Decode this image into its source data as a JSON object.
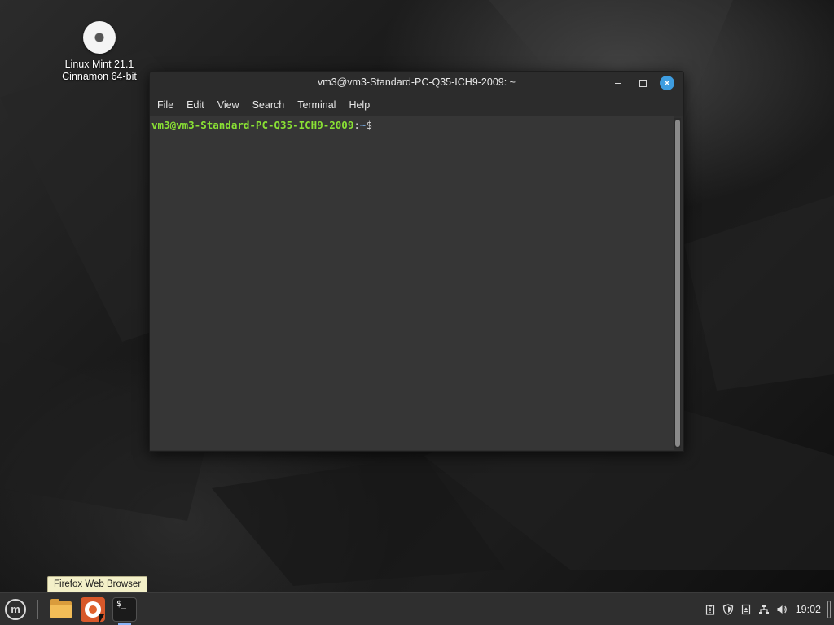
{
  "desktop": {
    "icon": {
      "name": "disc-icon",
      "label_line1": "Linux Mint 21.1",
      "label_line2": "Cinnamon 64-bit"
    }
  },
  "window": {
    "title": "vm3@vm3-Standard-PC-Q35-ICH9-2009: ~",
    "controls": {
      "minimize": "minimize",
      "maximize": "maximize",
      "close": "×"
    },
    "menu": [
      "File",
      "Edit",
      "View",
      "Search",
      "Terminal",
      "Help"
    ],
    "prompt": {
      "user_host": "vm3@vm3-Standard-PC-Q35-ICH9-2009",
      "separator": ":",
      "path": "~",
      "symbol": "$"
    }
  },
  "tooltip": {
    "text": "Firefox Web Browser"
  },
  "taskbar": {
    "menu_glyph": "m",
    "launchers": [
      "files",
      "firefox",
      "terminal"
    ],
    "terminal_glyph": "$_",
    "tray_icons": [
      "clipboard-icon",
      "shield-icon",
      "notes-icon",
      "network-icon",
      "volume-icon"
    ],
    "clock": "19:02"
  },
  "colors": {
    "prompt_user": "#8ae234",
    "prompt_path": "#729fcf",
    "close_button": "#3e9de0",
    "firefox_accent": "#d8582a"
  }
}
